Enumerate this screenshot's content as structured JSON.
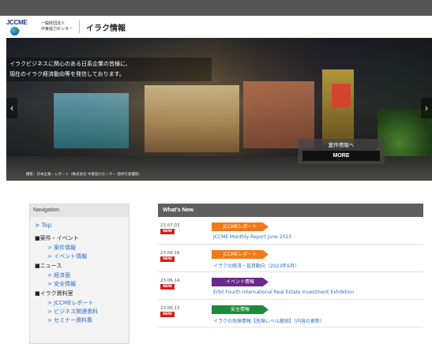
{
  "header": {
    "logo_text": "JCCME",
    "org_line1": "一般財団法人",
    "org_line2": "中東協力センター",
    "site_title": "イラク情報"
  },
  "hero": {
    "caption_line1": "イラクビジネスに関心のある日系企業の皆様に、",
    "caption_line2": "現在のイラク経済動向等を発信しております。",
    "prev_arrow": "‹",
    "next_arrow": "›",
    "more_label": "案件情報へ",
    "more_button": "MORE",
    "credit": "撮影：日本企業・レポート（株式会社 中東協力センター 提供写真撮影）"
  },
  "navigation": {
    "title": "Navigation",
    "top_link": "> Top",
    "sections": [
      {
        "label": "■案件・イベント",
        "items": [
          "> 案件情報",
          "> イベント情報"
        ]
      },
      {
        "label": "■ニュース",
        "items": [
          "> 経済面",
          "> 安全情報"
        ]
      },
      {
        "label": "■イラク資料室",
        "items": [
          "> JCCMEレポート",
          "> ビジネス関連資料",
          "> セミナー資料集"
        ]
      }
    ]
  },
  "whats_new": {
    "title": "What's New",
    "new_badge": "NEW",
    "items": [
      {
        "date": "23.07.03",
        "tag": "JCCMEレポート",
        "tag_color": "#f07a1a",
        "text": "JCCME Monthly Report June 2023"
      },
      {
        "date": "23.06.16",
        "tag": "JCCMEレポート",
        "tag_color": "#f07a1a",
        "text": "イラクの経済・投資動向（2023年6月）"
      },
      {
        "date": "23.06.14",
        "tag": "イベント情報",
        "tag_color": "#6b2a8a",
        "text": "Erbil Fourth International Real Estate Investment Exhibition"
      },
      {
        "date": "23.06.13",
        "tag": "安全情報",
        "tag_color": "#1e8a3a",
        "text": "イラクの危険情報【危険レベル継続】（内容の更新）"
      }
    ]
  }
}
